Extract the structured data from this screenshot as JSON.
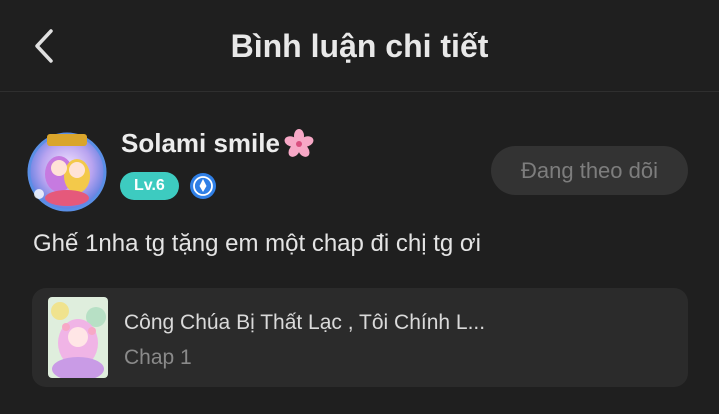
{
  "header": {
    "title": "Bình luận chi tiết",
    "back_icon": "chevron-left-icon"
  },
  "user": {
    "name": "Solami smile",
    "name_emoji": "🌸",
    "level": "Lv.6",
    "verified_icon": "blue-badge-icon",
    "follow_label": "Đang theo dõi"
  },
  "comment": {
    "text": "Ghế 1nha tg tặng em một chap đi chị tg ơi"
  },
  "story": {
    "title": "Công Chúa Bị Thất Lạc , Tôi Chính L...",
    "chapter": "Chap 1"
  },
  "colors": {
    "background": "#1f1f1f",
    "level_badge": "#3dcbc0",
    "card": "#2b2b2b",
    "follow_button": "#333333"
  }
}
